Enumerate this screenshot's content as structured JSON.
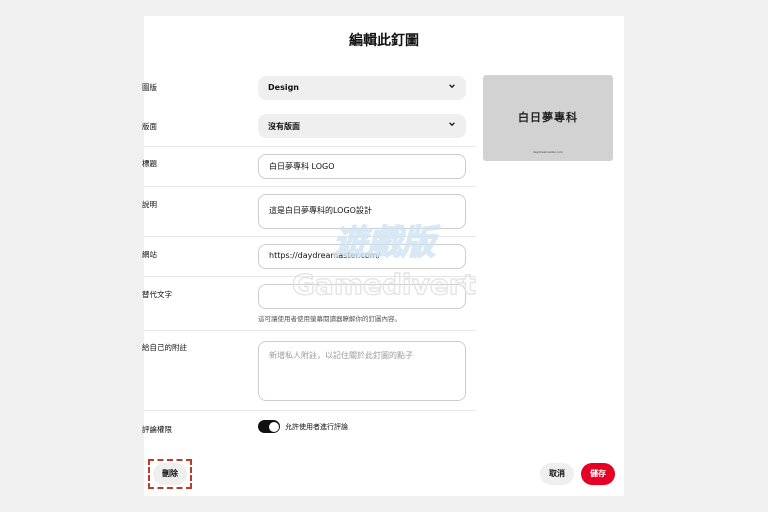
{
  "title": "編輯此釘圖",
  "fields": {
    "board": {
      "label": "圖版",
      "value": "Design"
    },
    "section": {
      "label": "版面",
      "value": "沒有版面"
    },
    "title": {
      "label": "標題",
      "value": "白日夢專科 LOGO"
    },
    "description": {
      "label": "說明",
      "value": "這是白日夢專科的LOGO設計"
    },
    "website": {
      "label": "網站",
      "value": "https://daydreamaster.com/"
    },
    "alt_text": {
      "label": "替代文字",
      "value": "",
      "helper": "這可讓使用者使用螢幕閱讀器瞭解你的釘圖內容。"
    },
    "note": {
      "label": "給自己的附註",
      "placeholder": "新增私人附註，以記住關於此釘圖的點子"
    },
    "comments": {
      "label": "評論權限",
      "toggle_label": "允許使用者進行評論",
      "enabled": true
    }
  },
  "preview": {
    "logo_text": "白日夢專科",
    "url_text": "daydreamaster.com"
  },
  "buttons": {
    "delete": "刪除",
    "cancel": "取消",
    "save": "儲存"
  },
  "watermark": {
    "line1": "遊戲版",
    "line2": "Gamedivert"
  },
  "colors": {
    "save": "#e60023",
    "highlight": "#c0392b"
  }
}
